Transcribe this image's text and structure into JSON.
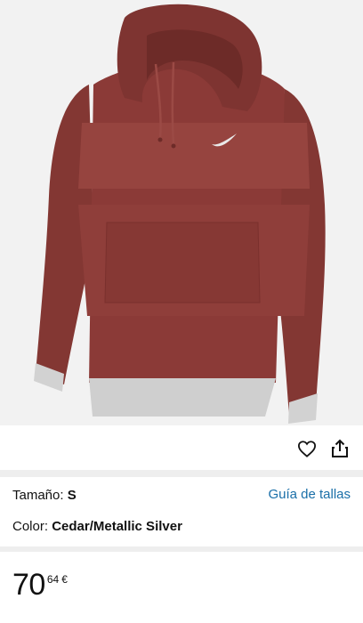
{
  "product": {
    "image_alt": "Nike hoodie in Cedar with Metallic Silver cuffs and hem",
    "primary_color": "#8a3a36",
    "fleece_color": "#92413d",
    "trim_color": "#cfcfcf"
  },
  "actions": {
    "favorite_icon": "heart-icon",
    "share_icon": "share-icon"
  },
  "details": {
    "size_label": "Tamaño:",
    "size_value": "S",
    "size_guide_link": "Guía de tallas",
    "color_label": "Color:",
    "color_value": "Cedar/Metallic Silver"
  },
  "price": {
    "whole": "70",
    "fraction": "64",
    "currency": "€"
  },
  "footer": {
    "faint_text": ""
  },
  "colors": {
    "link": "#1a6fa8",
    "divider": "#eeeeee",
    "background": "#ffffff"
  }
}
